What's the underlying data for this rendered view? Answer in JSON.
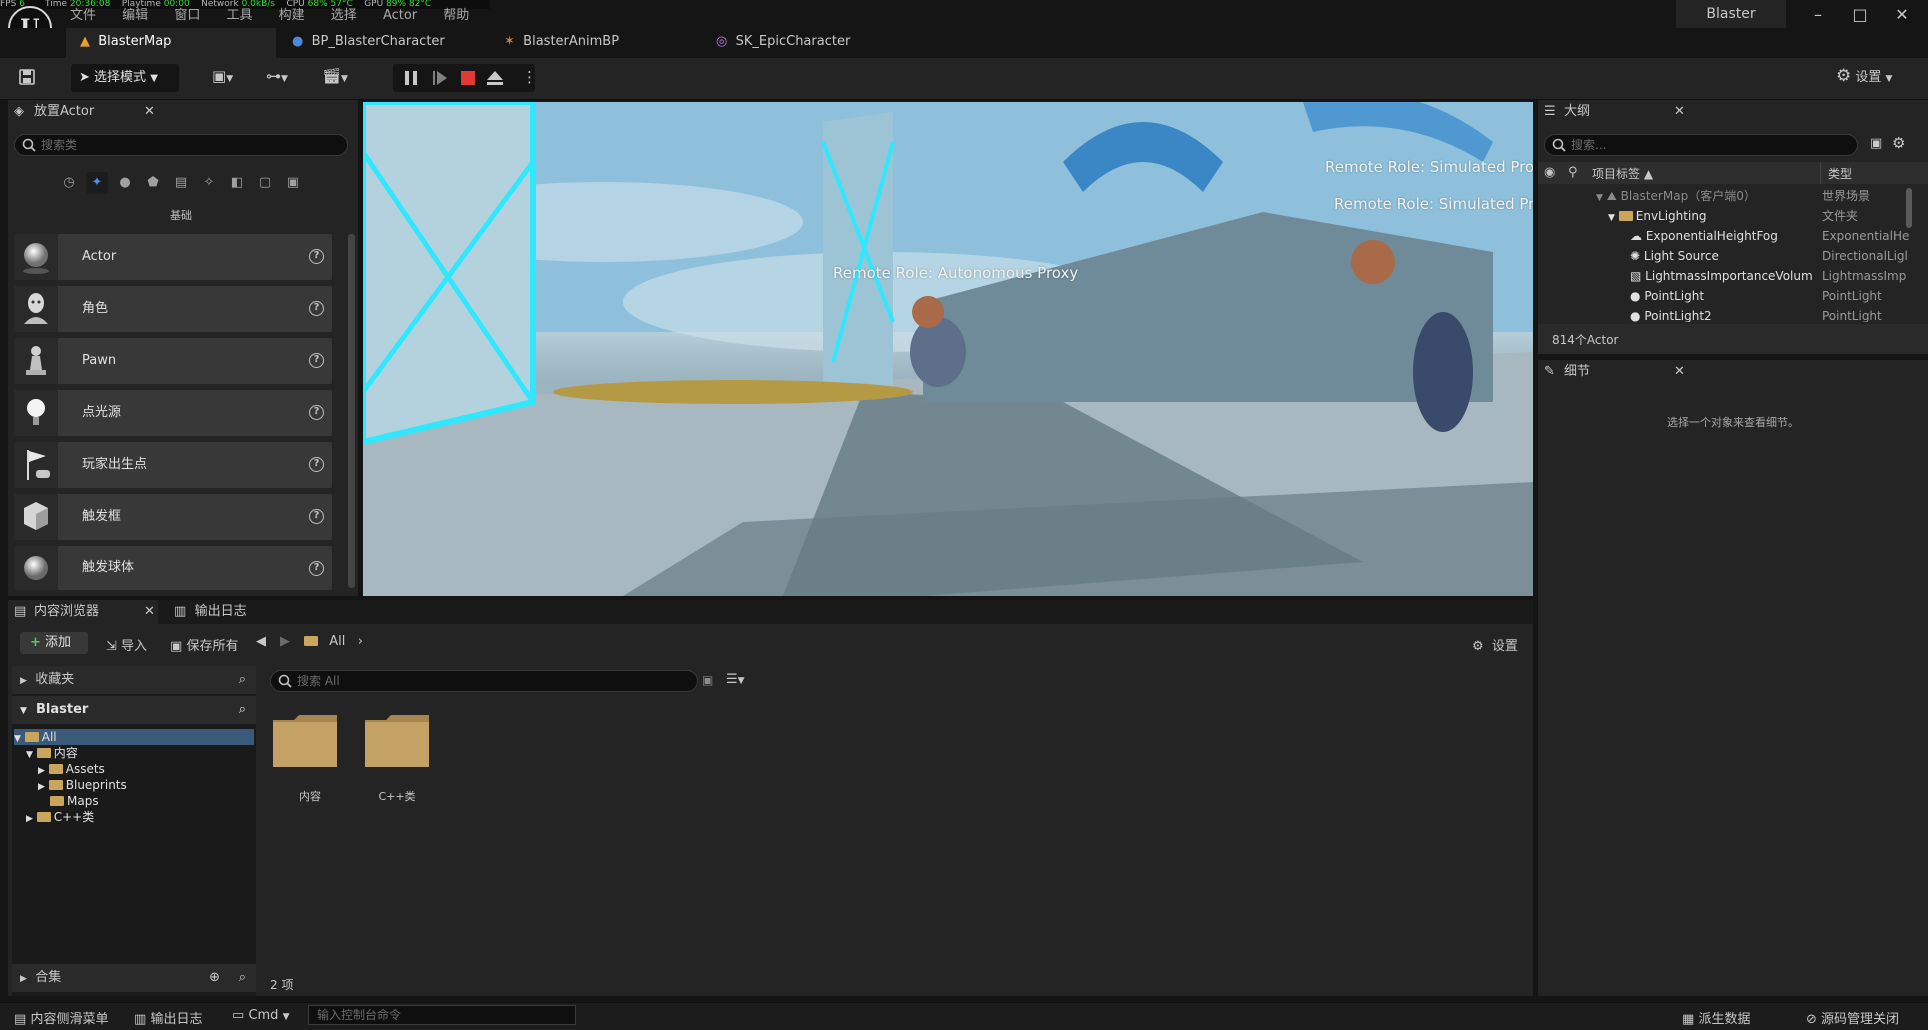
{
  "stats_bar": {
    "fps_label": "FPS",
    "fps_value": "6",
    "time_label": "Time",
    "time_value": "20:36:08",
    "playtime_label": "Playtime",
    "playtime_value": "00:00",
    "network_label": "Network",
    "network_value": "0.0kB/s",
    "cpu_label": "CPU",
    "cpu_value": "68% 57°C",
    "gpu_label": "GPU",
    "gpu_value": "89% 82°C"
  },
  "menu": [
    "文件",
    "编辑",
    "窗口",
    "工具",
    "构建",
    "选择",
    "Actor",
    "帮助"
  ],
  "window": {
    "project_name": "Blaster",
    "minimize": "–",
    "maximize": "□",
    "close": "✕"
  },
  "tabs": [
    {
      "label": "BlasterMap",
      "icon": "level-icon"
    },
    {
      "label": "BP_BlasterCharacter",
      "icon": "blueprint-icon"
    },
    {
      "label": "BlasterAnimBP",
      "icon": "anim-blueprint-icon"
    },
    {
      "label": "SK_EpicCharacter",
      "icon": "skeletal-mesh-icon"
    }
  ],
  "toolbar": {
    "mode_label": "选择模式",
    "settings_label": "设置"
  },
  "place_actors": {
    "tab_label": "放置Actor",
    "search_placeholder": "搜索类",
    "category_title": "基础",
    "items": [
      {
        "label": "Actor"
      },
      {
        "label": "角色"
      },
      {
        "label": "Pawn"
      },
      {
        "label": "点光源"
      },
      {
        "label": "玩家出生点"
      },
      {
        "label": "触发框"
      },
      {
        "label": "触发球体"
      }
    ]
  },
  "viewport": {
    "labels": [
      "Remote Role: Simulated Proxy",
      "Remote Role: Simulated Proxy",
      "Remote Role: Autonomous Proxy"
    ]
  },
  "outliner": {
    "tab_label": "大纲",
    "search_placeholder": "搜索...",
    "col_label": "项目标签 ▲",
    "col_type": "类型",
    "rows": [
      {
        "name": "BlasterMap（客户端0）",
        "type": "世界场景"
      },
      {
        "name": "EnvLighting",
        "type": "文件夹"
      },
      {
        "name": "ExponentialHeightFog",
        "type": "ExponentialHe"
      },
      {
        "name": "Light Source",
        "type": "DirectionalLigl"
      },
      {
        "name": "LightmassImportanceVolum",
        "type": "LightmassImp"
      },
      {
        "name": "PointLight",
        "type": "PointLight"
      },
      {
        "name": "PointLight2",
        "type": "PointLight"
      }
    ],
    "count": "814个Actor"
  },
  "details": {
    "tab_label": "细节",
    "empty_message": "选择一个对象来查看细节。"
  },
  "content_browser": {
    "tab_label": "内容浏览器",
    "output_log_tab": "输出日志",
    "add_label": "添加",
    "import_label": "导入",
    "save_all_label": "保存所有",
    "path_label": "All",
    "settings_label": "设置",
    "favorites_label": "收藏夹",
    "project_label": "Blaster",
    "tree": [
      "All",
      "内容",
      "Assets",
      "Blueprints",
      "Maps",
      "C++类"
    ],
    "search_placeholder": "搜索 All",
    "folders": [
      "内容",
      "C++类"
    ],
    "collections_label": "合集",
    "item_count": "2 项"
  },
  "status_bar": {
    "content_drawer": "内容侧滑菜单",
    "output_log": "输出日志",
    "cmd_label": "Cmd",
    "console_placeholder": "输入控制台命令",
    "derived_data": "派生数据",
    "source_control": "源码管理关闭"
  }
}
